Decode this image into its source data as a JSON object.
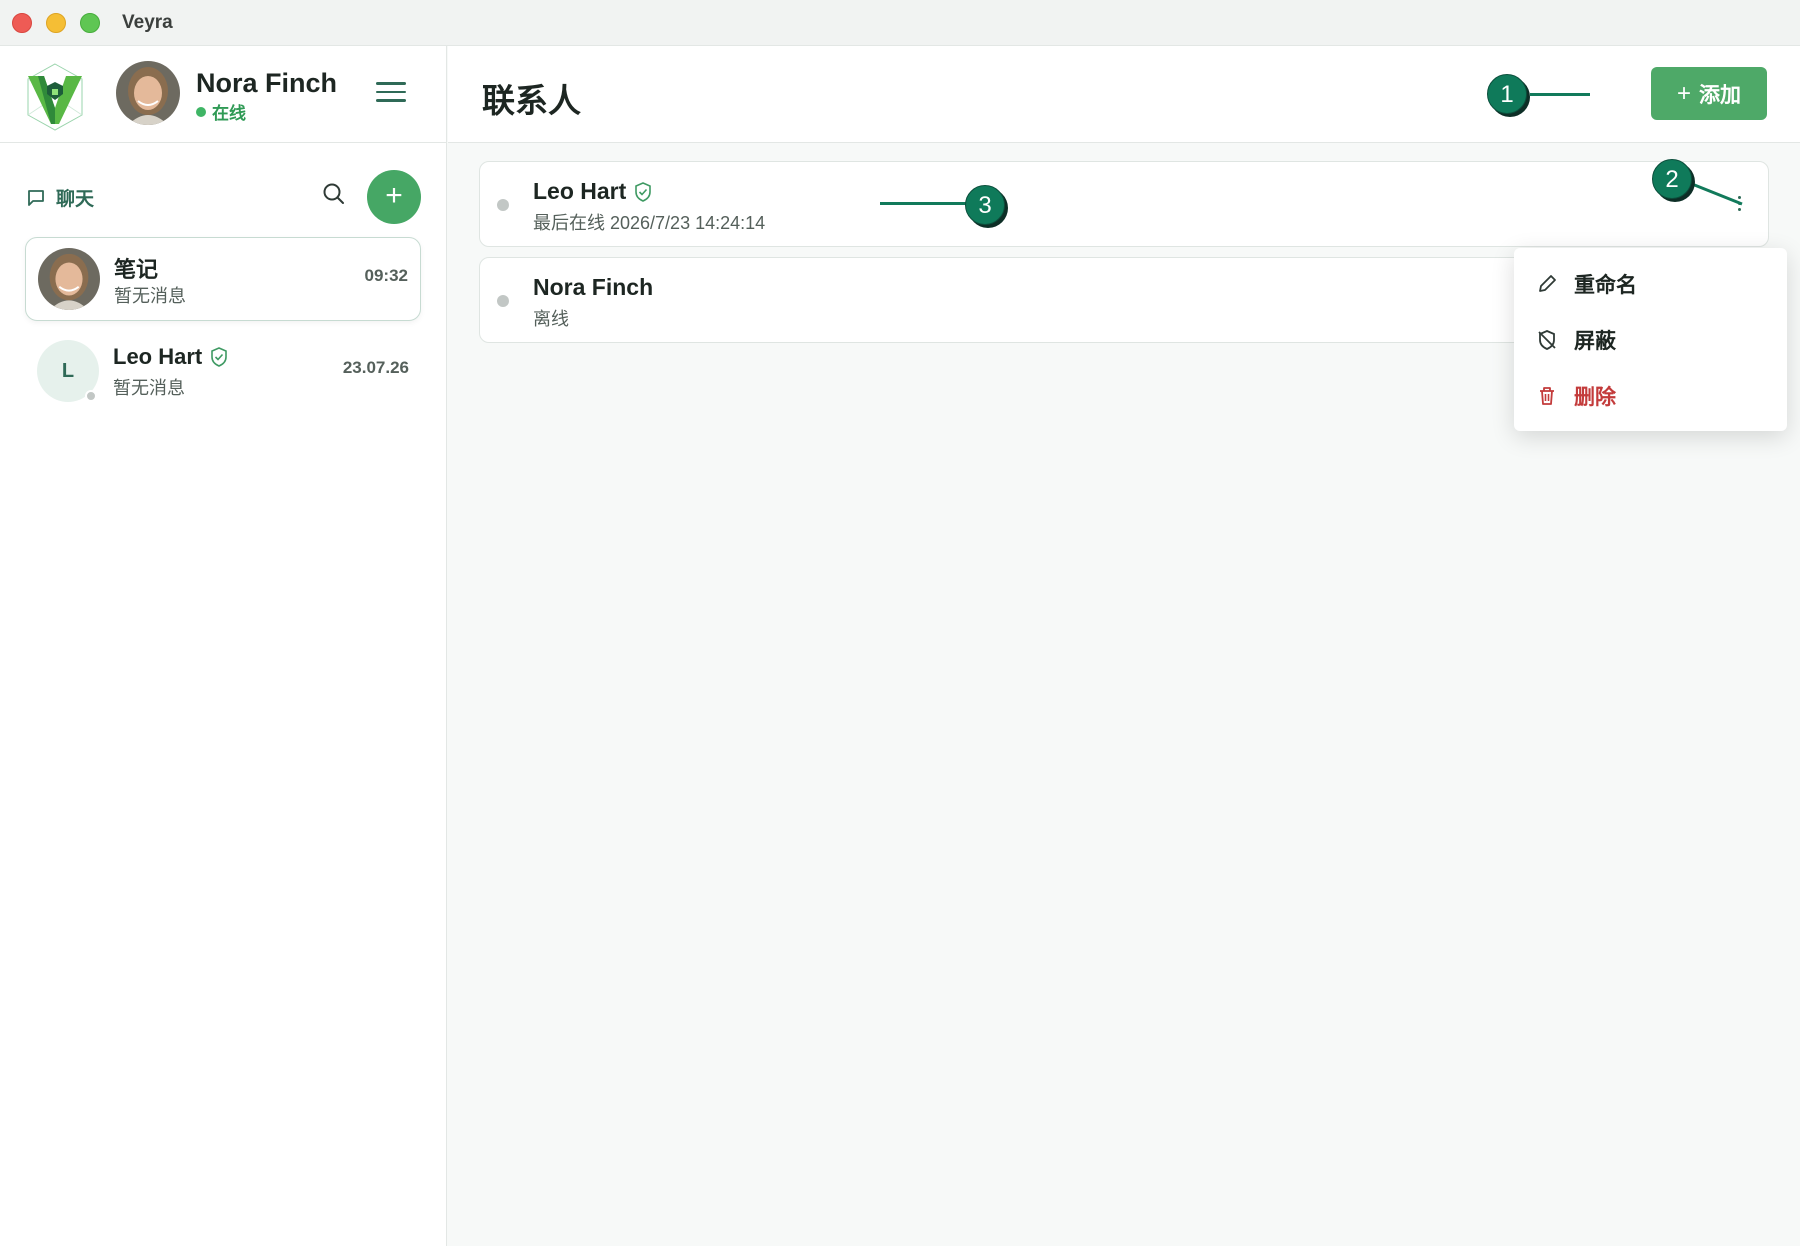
{
  "app": {
    "title": "Veyra"
  },
  "profile": {
    "name": "Nora Finch",
    "status": "在线"
  },
  "sidebar": {
    "section_label": "聊天",
    "chats": [
      {
        "title": "笔记",
        "subtitle": "暂无消息",
        "time": "09:32",
        "avatar": "photo-avatar"
      },
      {
        "title": "Leo Hart",
        "subtitle": "暂无消息",
        "time": "23.07.26",
        "avatar_letter": "L",
        "verified": true
      }
    ]
  },
  "main": {
    "title": "联系人",
    "add_button": {
      "icon": "plus",
      "label": "添加"
    },
    "contacts": [
      {
        "name": "Leo Hart",
        "status": "最后在线 2026/7/23 14:24:14",
        "verified": true
      },
      {
        "name": "Nora Finch",
        "status": "离线"
      }
    ]
  },
  "context_menu": {
    "items": [
      {
        "icon": "pencil-icon",
        "label": "重命名"
      },
      {
        "icon": "block-shield-icon",
        "label": "屏蔽"
      },
      {
        "icon": "trash-icon",
        "label": "删除",
        "color": "#c33b3b"
      }
    ]
  },
  "annotations": {
    "c1": "1",
    "c2": "2",
    "c3": "3"
  },
  "colors": {
    "accent": "#4ea968",
    "brand_dark": "#2f6a57",
    "danger": "#c33b3b",
    "annotation": "#0f7a5a"
  }
}
